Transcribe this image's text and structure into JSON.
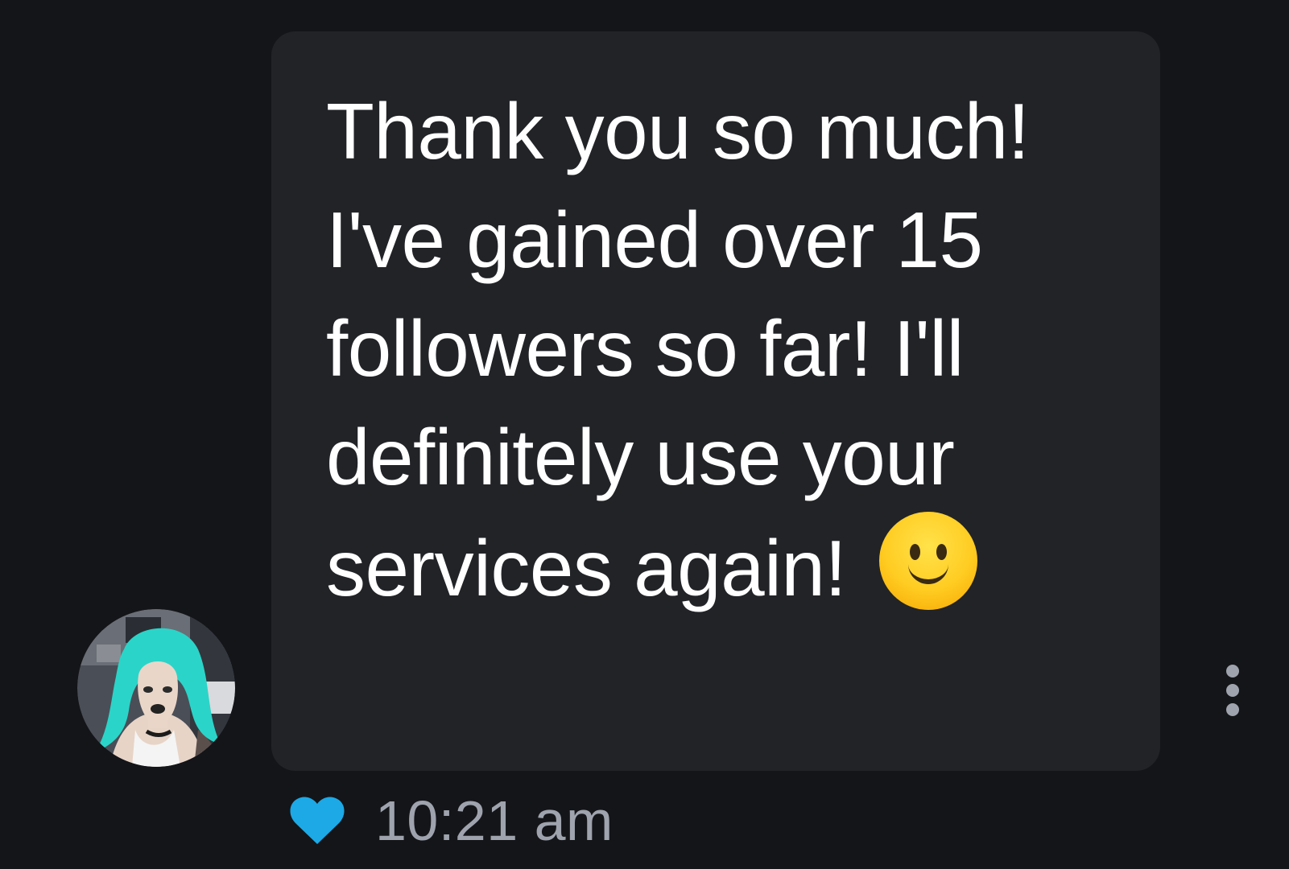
{
  "message": {
    "text": "Thank you so much! I've gained over 15 followers so far! I'll definitely use your services again!",
    "emoji": "slightly-smiling-face-emoji"
  },
  "footer": {
    "liked": true,
    "timestamp": "10:21 am"
  },
  "colors": {
    "background": "#141519",
    "bubble": "#222327",
    "text": "#ffffff",
    "heart": "#1ca9e6",
    "muted": "#9ea3ad"
  },
  "icons": {
    "avatar": "user-avatar",
    "more": "more-vertical-icon",
    "like": "heart-icon"
  }
}
